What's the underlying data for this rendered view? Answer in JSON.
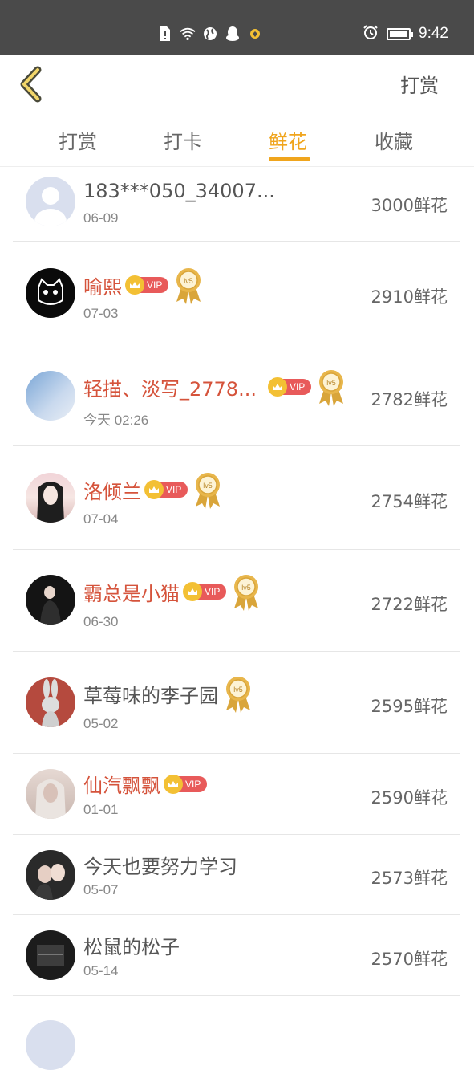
{
  "status_bar": {
    "time": "9:42"
  },
  "header": {
    "right_label": "打赏"
  },
  "tabs": [
    {
      "label": "打赏"
    },
    {
      "label": "打卡"
    },
    {
      "label": "鲜花"
    },
    {
      "label": "收藏"
    }
  ],
  "badges": {
    "vip_label": "VIP",
    "level_label": "lv5"
  },
  "list": [
    {
      "name": "183***050_34007...",
      "date": "06-09",
      "amount": "3000鲜花"
    },
    {
      "name": "喻熙",
      "date": "07-03",
      "amount": "2910鲜花"
    },
    {
      "name": "轻描、淡写_2778...",
      "date": "今天 02:26",
      "amount": "2782鲜花"
    },
    {
      "name": "洛倾兰",
      "date": "07-04",
      "amount": "2754鲜花"
    },
    {
      "name": "霸总是小猫",
      "date": "06-30",
      "amount": "2722鲜花"
    },
    {
      "name": "草莓味的李子园",
      "date": "05-02",
      "amount": "2595鲜花"
    },
    {
      "name": "仙汽飘飘",
      "date": "01-01",
      "amount": "2590鲜花"
    },
    {
      "name": "今天也要努力学习",
      "date": "05-07",
      "amount": "2573鲜花"
    },
    {
      "name": "松鼠的松子",
      "date": "05-14",
      "amount": "2570鲜花"
    }
  ]
}
